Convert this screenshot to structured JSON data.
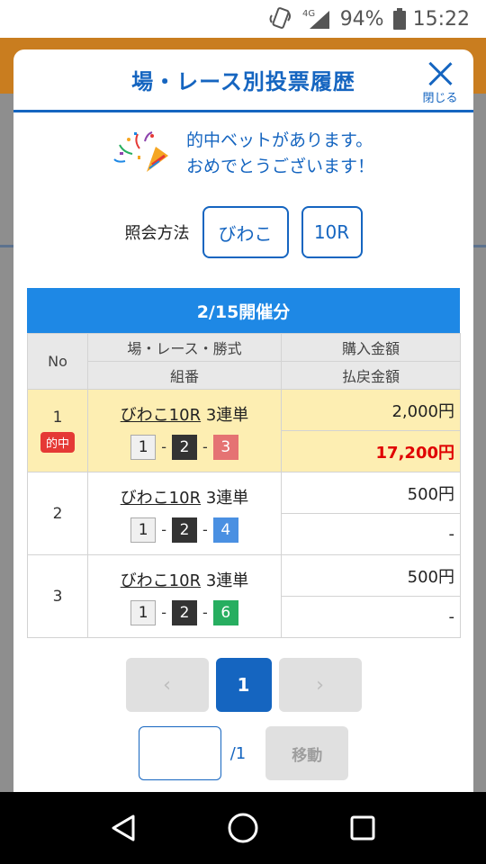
{
  "status": {
    "network": "4G",
    "battery": "94%",
    "time": "15:22"
  },
  "modal": {
    "title": "場・レース別投票履歴",
    "close_label": "閉じる",
    "hit_line1": "的中ベットがあります。",
    "hit_line2": "おめでとうございます！",
    "query_label": "照会方法",
    "query_venue": "びわこ",
    "query_race": "10R"
  },
  "table": {
    "date": "2/15開催分",
    "headers": {
      "no": "No",
      "bet_type": "場・レース・勝式",
      "combo": "組番",
      "purchase": "購入金額",
      "payout": "払戻金額"
    },
    "rows": [
      {
        "no": "1",
        "badge": "的中",
        "venue": "びわこ10R",
        "type": "3連単",
        "c1": "1",
        "c2": "2",
        "c3": "3",
        "purchase": "2,000円",
        "payout": "17,200円"
      },
      {
        "no": "2",
        "venue": "びわこ10R",
        "type": "3連単",
        "c1": "1",
        "c2": "2",
        "c3": "4",
        "purchase": "500円",
        "payout": "-"
      },
      {
        "no": "3",
        "venue": "びわこ10R",
        "type": "3連単",
        "c1": "1",
        "c2": "2",
        "c3": "6",
        "purchase": "500円",
        "payout": "-"
      }
    ]
  },
  "pager": {
    "prev": "‹",
    "current": "1",
    "next": "›",
    "total": "/1",
    "move_label": "移動"
  },
  "colors": {
    "primary": "#1565c0",
    "accent": "#1e88e5",
    "hit_row": "#fdeeb2",
    "hit_red": "#e00000"
  }
}
